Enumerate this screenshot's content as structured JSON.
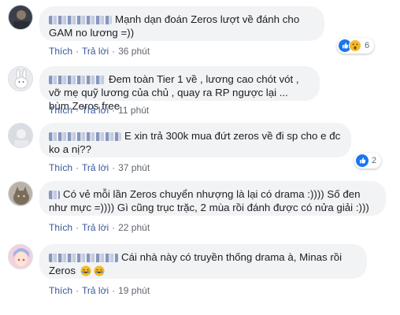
{
  "comments": [
    {
      "author": "",
      "text": "Mạnh dạn đoán Zeros lượt về đánh cho GAM no lương =))",
      "actions": {
        "like": "Thích",
        "reply": "Trả lời",
        "time": "36 phút"
      },
      "reactions": {
        "icons": [
          "like-icon",
          "wow-icon"
        ],
        "count": "6"
      },
      "avatar": "avatar-blurred-dark"
    },
    {
      "author": "",
      "text": "Đem toàn Tier 1 về , lương cao chót vót , vỡ mẹ quỹ lương của chủ , quay ra RP ngược lại ... bùm Zeros free",
      "actions": {
        "like": "Thích",
        "reply": "Trả lời",
        "time": "11 phút"
      },
      "avatar": "avatar-bunny"
    },
    {
      "author": "",
      "text": "E xin trả 300k mua đứt zeros về đi sp cho e đc ko a nị??",
      "actions": {
        "like": "Thích",
        "reply": "Trả lời",
        "time": "37 phút"
      },
      "reactions": {
        "icons": [
          "like-icon"
        ],
        "count": "2"
      },
      "avatar": "avatar-light"
    },
    {
      "author": "",
      "text": "Có vẻ mỗi lần Zeros chuyển nhượng là lại có drama :)))) Số đen như mực =)))) Gì cũng trục trặc, 2 mùa rồi đánh được có nửa giải :)))",
      "actions": {
        "like": "Thích",
        "reply": "Trả lời",
        "time": "22 phút"
      },
      "avatar": "avatar-cat"
    },
    {
      "author": "",
      "text": "Cái nhà này có truyền thống drama à, Minas rồi Zeros",
      "emoji": [
        "laugh-emoji",
        "laugh-emoji"
      ],
      "actions": {
        "like": "Thích",
        "reply": "Trả lời",
        "time": "19 phút"
      },
      "avatar": "avatar-anime"
    }
  ],
  "colors": {
    "link": "#385898",
    "bubble": "#f2f3f5",
    "meta": "#606770",
    "like_blue": "#1877f2",
    "wow_yellow": "#f7b928"
  }
}
